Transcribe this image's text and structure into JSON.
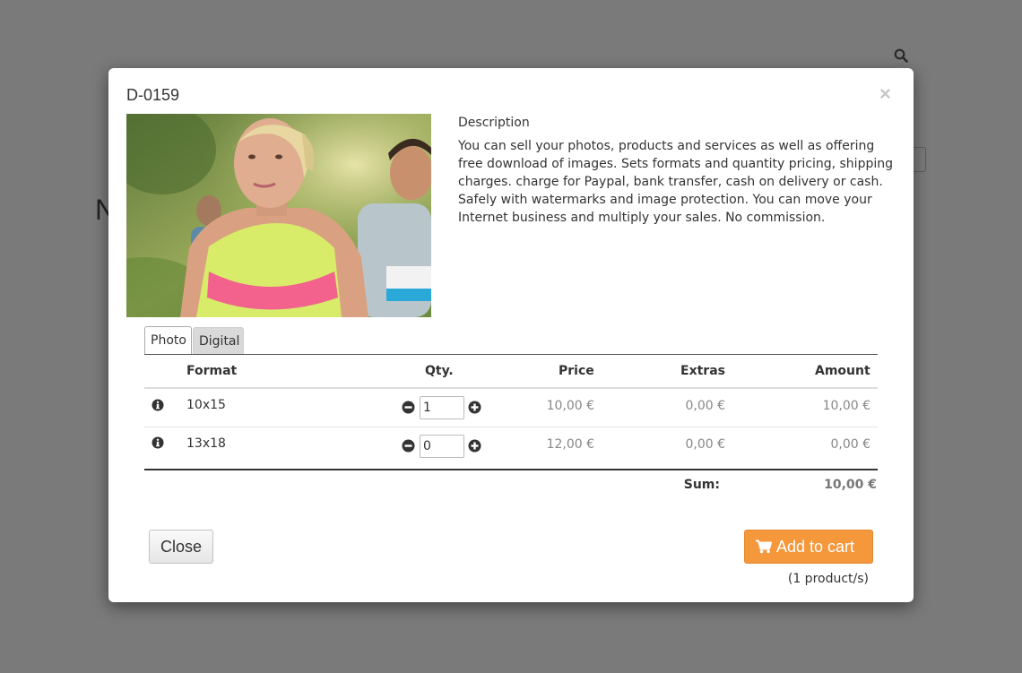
{
  "background": {
    "search_icon": "search-icon"
  },
  "modal": {
    "title": "D-0159",
    "close_symbol": "×",
    "description_heading": "Description",
    "description_text": "You can sell your photos, products and services as well as offering free download of images. Sets formats and quantity pricing, shipping charges. charge for Paypal, bank transfer, cash on delivery or cash. Safely with watermarks and image protection. You can move your Internet business and multiply your sales. No commission.",
    "tabs": [
      {
        "label": "Photo",
        "active": true
      },
      {
        "label": "Digital",
        "active": false
      }
    ],
    "table": {
      "headers": {
        "format": "Format",
        "qty": "Qty.",
        "price": "Price",
        "extras": "Extras",
        "amount": "Amount"
      },
      "rows": [
        {
          "format": "10x15",
          "qty": "1",
          "price": "10,00 €",
          "extras": "0,00 €",
          "amount": "10,00 €"
        },
        {
          "format": "13x18",
          "qty": "0",
          "price": "12,00 €",
          "extras": "0,00 €",
          "amount": "0,00 €"
        }
      ],
      "sum_label": "Sum:",
      "sum_value": "10,00 €"
    },
    "close_button": "Close",
    "add_to_cart_button": "Add to cart",
    "product_count": "(1 product/s)",
    "colors": {
      "accent": "#f5973b",
      "overlay": "#7a7a7a"
    }
  }
}
